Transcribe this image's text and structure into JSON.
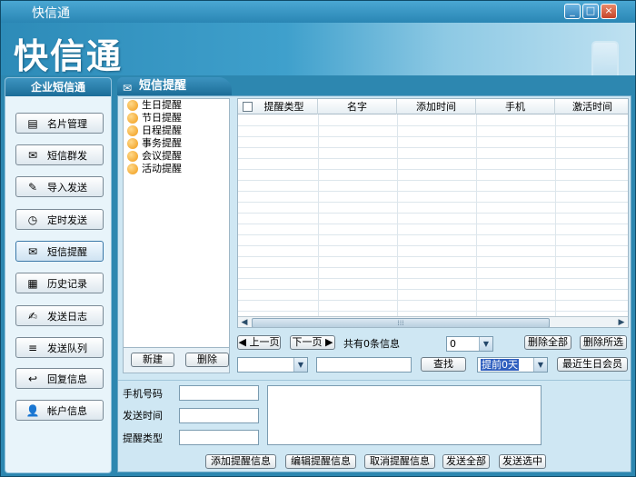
{
  "window": {
    "title": "快信通",
    "banner": "快信通",
    "controls": {
      "minimize": "_",
      "maximize": "□",
      "close": "×"
    }
  },
  "sidebar": {
    "title": "企业短信通",
    "items": [
      {
        "label": "名片管理",
        "icon": "▤"
      },
      {
        "label": "短信群发",
        "icon": "✉"
      },
      {
        "label": "导入发送",
        "icon": "✎"
      },
      {
        "label": "定时发送",
        "icon": "◷"
      },
      {
        "label": "短信提醒",
        "icon": "✉"
      },
      {
        "label": "历史记录",
        "icon": "▦"
      },
      {
        "label": "发送日志",
        "icon": "✍"
      },
      {
        "label": "发送队列",
        "icon": "≡"
      },
      {
        "label": "回复信息",
        "icon": "↩"
      },
      {
        "label": "帐户信息",
        "icon": "👤"
      }
    ]
  },
  "panel": {
    "title": "短信提醒",
    "tree": [
      "生日提醒",
      "节日提醒",
      "日程提醒",
      "事务提醒",
      "会议提醒",
      "活动提醒"
    ],
    "new_label": "新建",
    "delete_label": "删除",
    "columns": [
      "提醒类型",
      "名字",
      "添加时间",
      "手机",
      "激活时间"
    ],
    "pager": {
      "prev": "上一页",
      "next": "下一页",
      "info": "共有0条信息",
      "page_select": "0",
      "delete_all": "删除全部",
      "delete_selected": "删除所选"
    },
    "filter": {
      "type_select": "",
      "keyword": "",
      "search": "查找",
      "advance_select": "提前0天",
      "recent_birthday": "最近生日会员"
    },
    "form": {
      "phone_label": "手机号码",
      "time_label": "发送时间",
      "type_label": "提醒类型"
    },
    "actions": {
      "add": "添加提醒信息",
      "edit": "编辑提醒信息",
      "cancel": "取消提醒信息",
      "send_all": "发送全部",
      "send_selected": "发送选中"
    }
  }
}
